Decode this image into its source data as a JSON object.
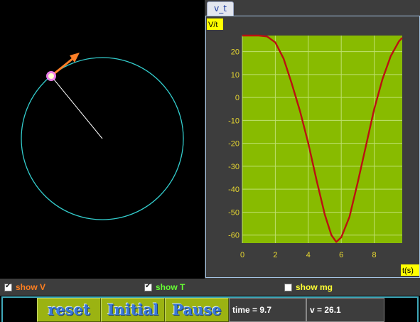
{
  "tab": {
    "label": "v_t"
  },
  "graph": {
    "ylabel": "V/t",
    "xlabel": "t(s)",
    "plot_bg": "#88bb00",
    "curve_color": "#bb1111",
    "label_bg": "#ffff00"
  },
  "checkboxes": {
    "show_v": {
      "label": "show V",
      "checked": true,
      "color": "#ff7f20"
    },
    "show_t": {
      "label": "show T",
      "checked": true,
      "color": "#66ff33"
    },
    "show_mg": {
      "label": "show mg",
      "checked": false,
      "color": "#ffff33"
    }
  },
  "buttons": {
    "reset": "reset",
    "initial": "Initial",
    "pause": "Pause"
  },
  "readouts": {
    "time": "time = 9.7",
    "velocity": "v = 26.1"
  },
  "simulation": {
    "ball_angle_deg": 124,
    "circle_color": "#33cccc",
    "string_color": "#ffffff",
    "velocity_arrow_color": "#ff7f27"
  },
  "chart_data": {
    "type": "line",
    "xlim": [
      0,
      9.7
    ],
    "ylim": [
      -63.5,
      27
    ],
    "xticks": [
      0,
      2,
      4,
      6,
      8
    ],
    "yticks": [
      20,
      10,
      0,
      -10,
      -20,
      -30,
      -40,
      -50,
      -60
    ],
    "grid": true,
    "series": [
      {
        "x": [
          0,
          0.5,
          1.0,
          1.5,
          2.0,
          2.5,
          3.0,
          3.5,
          4.0,
          4.5,
          5.0,
          5.4,
          5.7,
          6.0,
          6.5,
          7.0,
          7.5,
          8.0,
          8.5,
          9.0,
          9.5,
          9.7
        ],
        "y": [
          27,
          27,
          27,
          26.6,
          24,
          17,
          6,
          -6,
          -20,
          -36,
          -51,
          -60,
          -63,
          -61,
          -52,
          -37,
          -21,
          -5,
          8,
          18,
          24.5,
          26
        ]
      }
    ]
  }
}
